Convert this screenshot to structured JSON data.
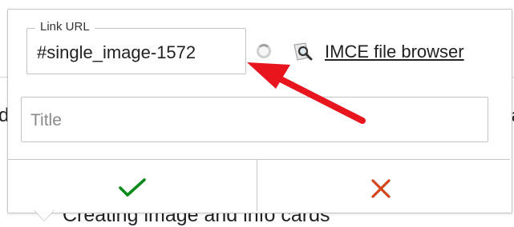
{
  "background": {
    "left_fragment": "d",
    "right_fragment": "fa",
    "caption": "Creating image and info cards"
  },
  "link_form": {
    "url_label": "Link URL",
    "url_value": "#single_image-1572",
    "file_browser_link": "IMCE file browser",
    "title_placeholder": "Title"
  },
  "actions": {
    "save_icon": "check-icon",
    "cancel_icon": "x-icon"
  },
  "colors": {
    "save": "#0a8a1a",
    "cancel": "#d4431a",
    "annotation": "#e8141e"
  }
}
